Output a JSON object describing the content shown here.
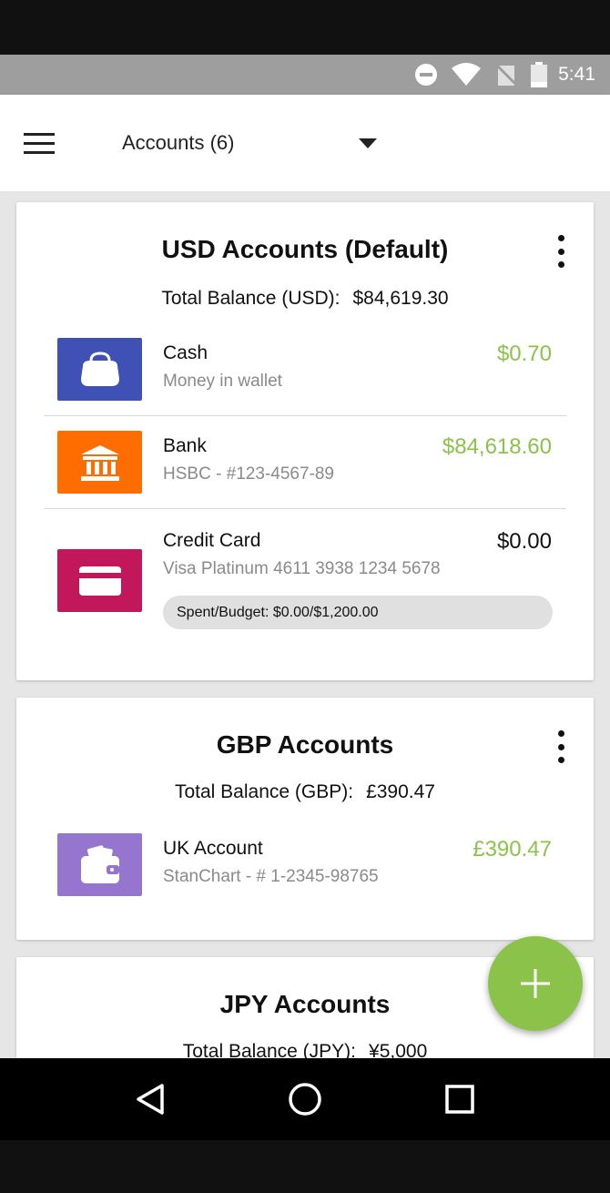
{
  "status_bar": {
    "time": "5:41"
  },
  "app_bar": {
    "selector_label": "Accounts (6)"
  },
  "colors": {
    "positive": "#8bc34a",
    "fab": "#8bc34a"
  },
  "groups": [
    {
      "title": "USD Accounts (Default)",
      "total_label": "Total Balance (USD):",
      "total_amount": "$84,619.30",
      "accounts": [
        {
          "name": "Cash",
          "subtitle": "Money in wallet",
          "amount": "$0.70",
          "icon": "coin-purse-icon",
          "icon_color": "#3f51b5"
        },
        {
          "name": "Bank",
          "subtitle": "HSBC - #123-4567-89",
          "amount": "$84,618.60",
          "icon": "bank-icon",
          "icon_color": "#ff6d00"
        },
        {
          "name": "Credit Card",
          "subtitle": "Visa Platinum 4611 3938 1234 5678",
          "amount": "$0.00",
          "icon": "credit-card-icon",
          "icon_color": "#c2185b",
          "budget": "Spent/Budget: $0.00/$1,200.00"
        }
      ]
    },
    {
      "title": "GBP Accounts",
      "total_label": "Total Balance (GBP):",
      "total_amount": "£390.47",
      "accounts": [
        {
          "name": "UK Account",
          "subtitle": "StanChart - # 1-2345-98765",
          "amount": "£390.47",
          "icon": "wallet-icon",
          "icon_color": "#9575cd"
        }
      ]
    },
    {
      "title": "JPY Accounts",
      "total_label": "Total Balance (JPY):",
      "total_amount": "¥5,000",
      "accounts": []
    }
  ]
}
